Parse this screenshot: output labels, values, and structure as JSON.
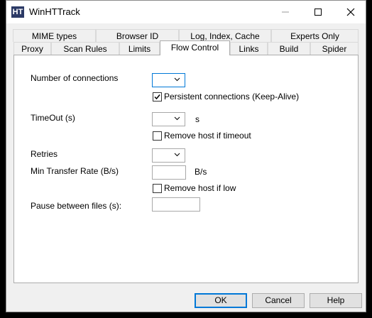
{
  "window": {
    "title": "WinHTTrack",
    "app_icon_text": "HT"
  },
  "tabs": {
    "row1": [
      "MIME types",
      "Browser ID",
      "Log, Index, Cache",
      "Experts Only"
    ],
    "row2": [
      "Proxy",
      "Scan Rules",
      "Limits",
      "Flow Control",
      "Links",
      "Build",
      "Spider"
    ],
    "active": "Flow Control"
  },
  "form": {
    "connections_label": "Number of connections",
    "connections_value": "",
    "keepalive_label": "Persistent connections (Keep-Alive)",
    "keepalive_checked": true,
    "timeout_label": "TimeOut (s)",
    "timeout_value": "",
    "timeout_unit": "s",
    "remove_timeout_label": "Remove host if timeout",
    "remove_timeout_checked": false,
    "retries_label": "Retries",
    "retries_value": "",
    "min_rate_label": "Min Transfer Rate (B/s)",
    "min_rate_value": "",
    "min_rate_unit": "B/s",
    "remove_low_label": "Remove host if low",
    "remove_low_checked": false,
    "pause_label": "Pause between files (s):",
    "pause_value": ""
  },
  "buttons": {
    "ok": "OK",
    "cancel": "Cancel",
    "help": "Help"
  }
}
